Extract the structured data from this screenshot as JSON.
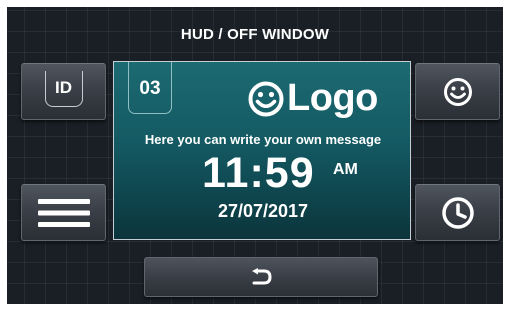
{
  "window_title": "HUD / OFF WINDOW",
  "buttons": {
    "id_label": "ID",
    "id_icon": "id-badge-icon",
    "menu_icon": "hamburger-menu-icon",
    "smiley_icon": "smiley-face-icon",
    "clock_icon": "clock-icon",
    "back_icon": "return-arrow-icon"
  },
  "display": {
    "number": "03",
    "logo_text": "Logo",
    "logo_icon": "smiley-face-icon",
    "message": "Here you can write your own message",
    "time": "11:59",
    "ampm": "AM",
    "date": "27/07/2017"
  },
  "colors": {
    "background": "#1a1f26",
    "panel_top": "#1c6a72",
    "panel_bottom": "#0c343b",
    "text": "#ffffff"
  }
}
